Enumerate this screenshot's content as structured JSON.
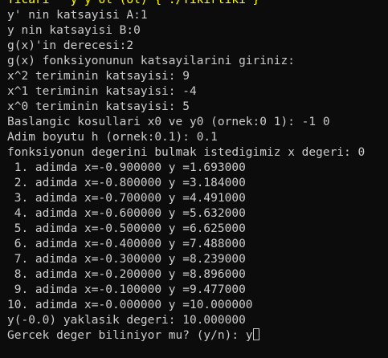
{
  "terminal": {
    "top_partial": "Ticari ^ y y ol (ol) { ./Tikirtiki }",
    "lines": [
      "y' nin katsayisi A:1",
      "y nin katsayisi B:0",
      "g(x)'in derecesi:2",
      "g(x) fonksiyonunun katsayilarini giriniz:",
      "x^2 teriminin katsayisi: 9",
      "x^1 teriminin katsayisi: -4",
      "x^0 teriminin katsayisi: 5",
      "Baslangic kosullari x0 ve y0 (ornek:0 1): -1 0",
      "Adim boyutu h (ornek:0.1): 0.1",
      "fonksiyonun degerini bulmak istedigimiz x degeri: 0",
      " 1. adimda x=-0.900000 y =1.693000",
      " 2. adimda x=-0.800000 y =3.184000",
      " 3. adimda x=-0.700000 y =4.491000",
      " 4. adimda x=-0.600000 y =5.632000",
      " 5. adimda x=-0.500000 y =6.625000",
      " 6. adimda x=-0.400000 y =7.488000",
      " 7. adimda x=-0.300000 y =8.239000",
      " 8. adimda x=-0.200000 y =8.896000",
      " 9. adimda x=-0.100000 y =9.477000",
      "10. adimda x=-0.000000 y =10.000000",
      "y(-0.0) yaklasik degeri: 10.000000"
    ],
    "prompt": "Gercek deger biliniyor mu? (y/n): ",
    "input_value": "y"
  }
}
